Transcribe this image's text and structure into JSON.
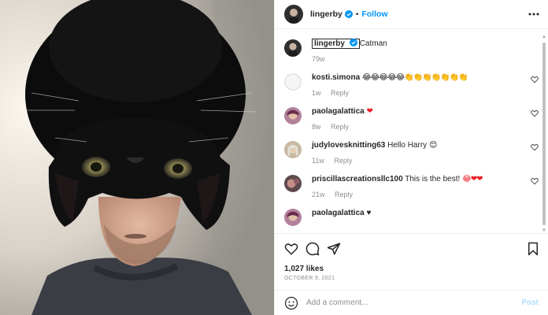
{
  "post": {
    "author": "lingerby",
    "follow_label": "Follow",
    "separator": "•",
    "caption_text": "Catman",
    "caption_age": "79w",
    "likes": "1,027 likes",
    "date": "OCTOBER 9, 2021",
    "comment_placeholder": "Add a comment...",
    "post_label": "Post"
  },
  "comments": [
    {
      "user": "kosti.simona",
      "text": "",
      "emoji": "😂😂😂😂😂👏👏👏👏👏👏👏",
      "age": "1w",
      "reply": "Reply"
    },
    {
      "user": "paolagalattica",
      "text": "",
      "emoji": "❤",
      "age": "8w",
      "reply": "Reply"
    },
    {
      "user": "judylovesknitting63",
      "text": "Hello Harry ",
      "emoji": "😊",
      "age": "11w",
      "reply": "Reply"
    },
    {
      "user": "priscillascreationsllc100",
      "text": "This is the best! ",
      "emoji": "😂❤❤",
      "age": "21w",
      "reply": "Reply"
    },
    {
      "user": "paolagalattica",
      "text": "",
      "emoji": "♥",
      "age": "",
      "reply": ""
    }
  ],
  "icons": {
    "verified": "verified-badge-icon",
    "more": "more-options-icon",
    "like": "heart-icon",
    "comment": "comment-bubble-icon",
    "share": "paper-plane-icon",
    "save": "bookmark-icon",
    "emoji": "smiley-icon"
  },
  "colors": {
    "accent": "#0095f6",
    "post_disabled": "#b2dffc",
    "meta": "#8e8e8e",
    "heart_red": "#ed1c24"
  }
}
